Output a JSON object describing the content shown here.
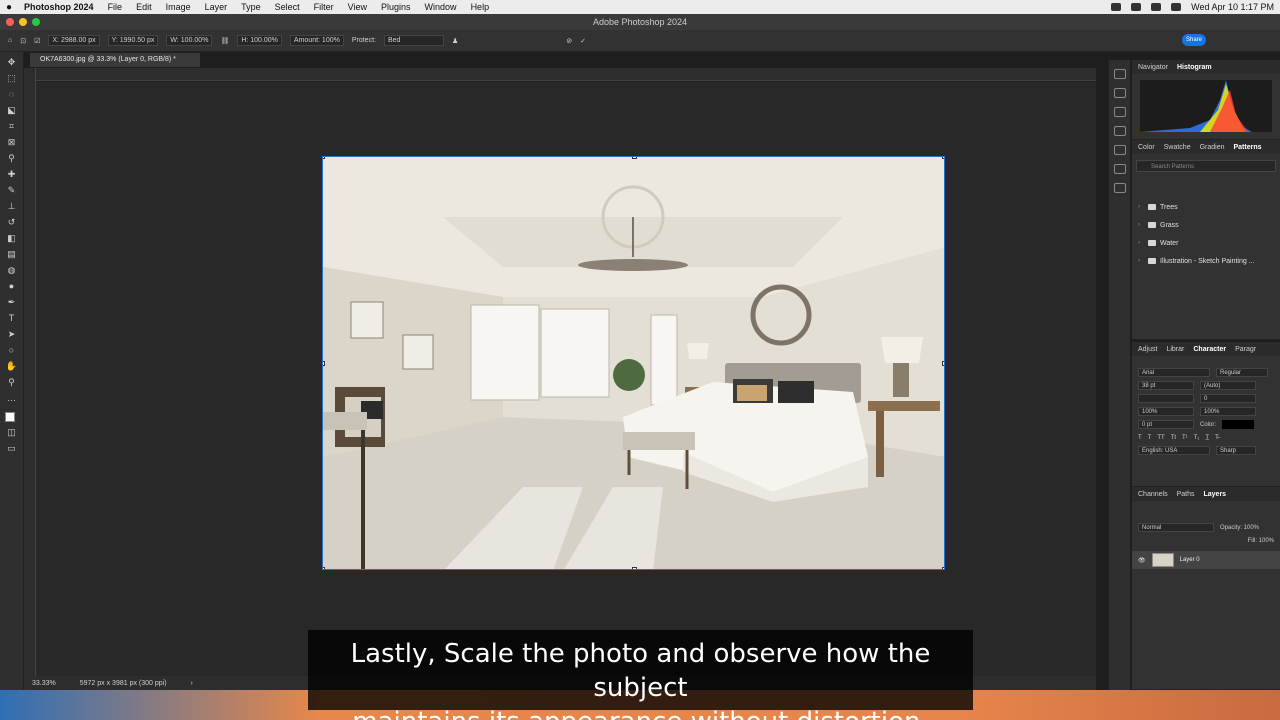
{
  "menubar": {
    "app_name": "Photoshop 2024",
    "items": [
      "File",
      "Edit",
      "Image",
      "Layer",
      "Type",
      "Select",
      "Filter",
      "View",
      "Plugins",
      "Window",
      "Help"
    ],
    "clock": "Wed Apr 10  1:17 PM"
  },
  "window": {
    "title": "Adobe Photoshop 2024"
  },
  "options": {
    "x": "X: 2988.00 px",
    "y": "Y: 1990.50 px",
    "w": "W: 100.00%",
    "h": "H: 100.00%",
    "amount": "Amount: 100%",
    "protect": "Protect:",
    "protect_value": "Bed",
    "share": "Share"
  },
  "document": {
    "tab_title": "OK7A6300.jpg @ 33.3% (Layer 0, RGB/8) *"
  },
  "status": {
    "zoom": "33.33%",
    "doc_info": "5972 px x 3981 px (300 ppi)"
  },
  "panels": {
    "top_tabs": [
      "Navigator",
      "Histogram"
    ],
    "mid_tabs": [
      "Color",
      "Swatche",
      "Gradien",
      "Patterns"
    ],
    "search_placeholder": "Search Patterns",
    "pattern_folders": [
      "Trees",
      "Grass",
      "Water",
      "Illustration - Sketch Painting ..."
    ],
    "char_tabs": [
      "Adjust",
      "Librar",
      "Character",
      "Paragr"
    ],
    "font_family": "Arial",
    "font_style": "Regular",
    "font_size": "38 pt",
    "leading": "(Auto)",
    "tracking": "0",
    "vscale": "100%",
    "hscale": "100%",
    "baseline": "0 pt",
    "color_label": "Color:",
    "language": "English: USA",
    "antialias": "Sharp",
    "layer_tabs": [
      "Channels",
      "Paths",
      "Layers"
    ],
    "blend_mode": "Normal",
    "opacity": "Opacity: 100%",
    "fill": "Fill: 100%",
    "layer_name": "Layer 0"
  },
  "caption": {
    "line1": "Lastly, Scale the photo and observe how the subject",
    "line2": "maintains its appearance without distortion."
  }
}
